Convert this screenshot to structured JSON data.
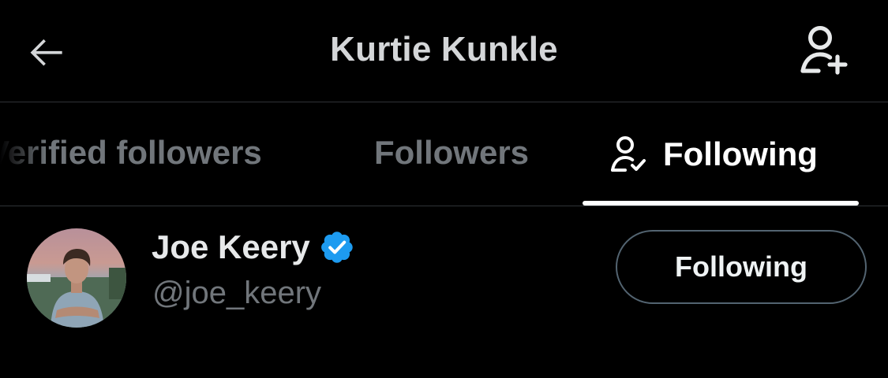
{
  "header": {
    "title": "Kurtie Kunkle",
    "back_icon": "arrow-left-icon",
    "add_user_icon": "person-plus-icon"
  },
  "tabs": [
    {
      "label": "Verified followers",
      "active": false
    },
    {
      "label": "Followers",
      "active": false
    },
    {
      "label": "Following",
      "active": true,
      "icon": "person-check-icon"
    }
  ],
  "users": [
    {
      "name": "Joe Keery",
      "handle": "@joe_keery",
      "verified": true,
      "badge_color": "#1d9bf0",
      "button_label": "Following"
    }
  ],
  "colors": {
    "background": "#000000",
    "primary_text": "#e7e9ea",
    "secondary_text": "#71767b",
    "divider": "#2f3336",
    "verified_blue": "#1d9bf0"
  }
}
